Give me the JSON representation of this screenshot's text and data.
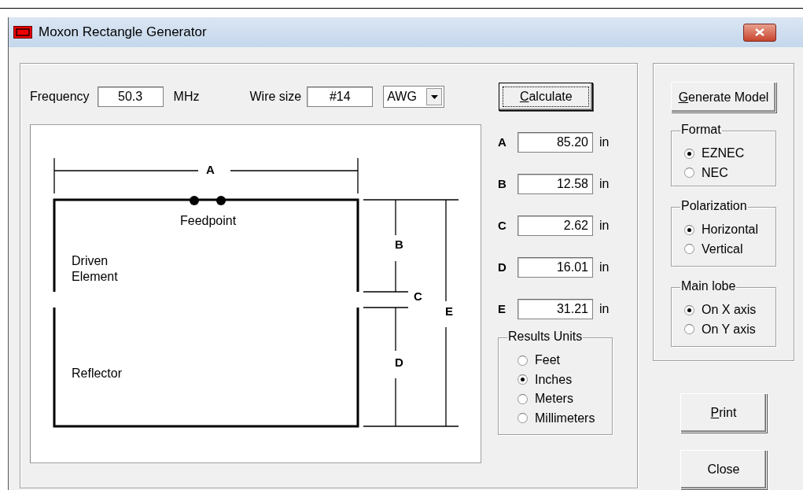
{
  "window": {
    "title": "Moxon Rectangle Generator"
  },
  "frequency": {
    "label": "Frequency",
    "value": "50.3",
    "unit": "MHz"
  },
  "wire_size": {
    "label": "Wire size",
    "value": "#14",
    "unit": "AWG"
  },
  "calculate_button": {
    "label": "Calculate",
    "mnemonic": true,
    "focused": true
  },
  "diagram": {
    "dimension_labels": [
      "A",
      "B",
      "C",
      "D",
      "E"
    ],
    "feedpoint": "Feedpoint",
    "driven": "Driven Element",
    "reflector": "Reflector"
  },
  "results": [
    {
      "name": "A",
      "value": "85.20",
      "unit": "in"
    },
    {
      "name": "B",
      "value": "12.58",
      "unit": "in"
    },
    {
      "name": "C",
      "value": "2.62",
      "unit": "in"
    },
    {
      "name": "D",
      "value": "16.01",
      "unit": "in"
    },
    {
      "name": "E",
      "value": "31.21",
      "unit": "in"
    }
  ],
  "results_units": {
    "title": "Results Units",
    "options": [
      {
        "label": "Feet",
        "selected": false
      },
      {
        "label": "Inches",
        "selected": true
      },
      {
        "label": "Meters",
        "selected": false
      },
      {
        "label": "Millimeters",
        "selected": false
      }
    ]
  },
  "generate_button": {
    "label": "Generate Model",
    "mnemonic": true,
    "focused": false
  },
  "option_groups": [
    {
      "title": "Format",
      "options": [
        {
          "label": "EZNEC",
          "selected": true
        },
        {
          "label": "NEC",
          "selected": false
        }
      ]
    },
    {
      "title": "Polarization",
      "options": [
        {
          "label": "Horizontal",
          "selected": true
        },
        {
          "label": "Vertical",
          "selected": false
        }
      ]
    },
    {
      "title": "Main lobe",
      "options": [
        {
          "label": "On X axis",
          "selected": true
        },
        {
          "label": "On Y axis",
          "selected": false
        }
      ]
    }
  ],
  "print_button": {
    "label": "Print",
    "mnemonic": true,
    "focused": false
  },
  "close_button": {
    "label": "Close",
    "mnemonic": false,
    "focused": false
  }
}
